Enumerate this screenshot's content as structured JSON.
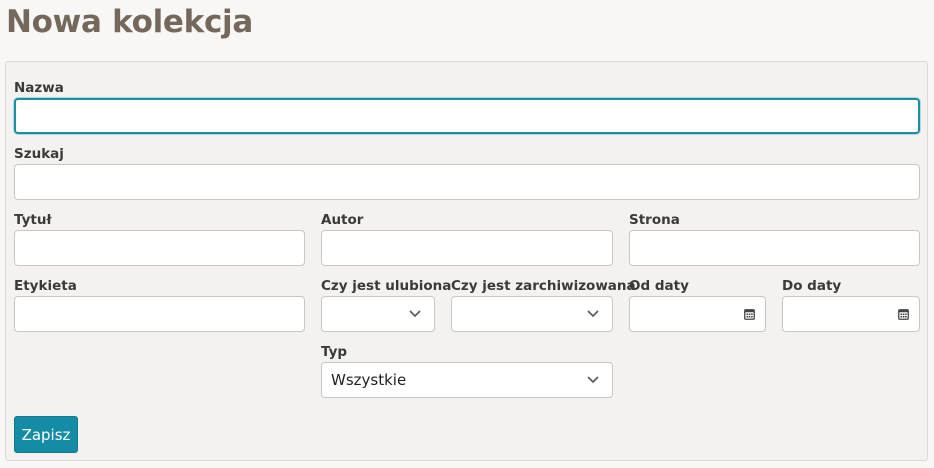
{
  "page": {
    "title": "Nowa kolekcja"
  },
  "form": {
    "name": {
      "label": "Nazwa",
      "value": ""
    },
    "search": {
      "label": "Szukaj",
      "value": ""
    },
    "title": {
      "label": "Tytuł",
      "value": ""
    },
    "author": {
      "label": "Autor",
      "value": ""
    },
    "site": {
      "label": "Strona",
      "value": ""
    },
    "tag": {
      "label": "Etykieta",
      "value": ""
    },
    "favorite": {
      "label": "Czy jest ulubiona",
      "value": ""
    },
    "archived": {
      "label": "Czy jest zarchiwizowana",
      "value": ""
    },
    "date_from": {
      "label": "Od daty",
      "value": ""
    },
    "date_to": {
      "label": "Do daty",
      "value": ""
    },
    "type": {
      "label": "Typ",
      "value": "Wszystkie"
    },
    "submit_label": "Zapisz"
  },
  "icons": {
    "select": "chevron-down-icon",
    "date": "calendar-icon"
  },
  "colors": {
    "accent": "#158ca6",
    "focus_ring": "#1d8ea0",
    "title": "#74685c"
  }
}
